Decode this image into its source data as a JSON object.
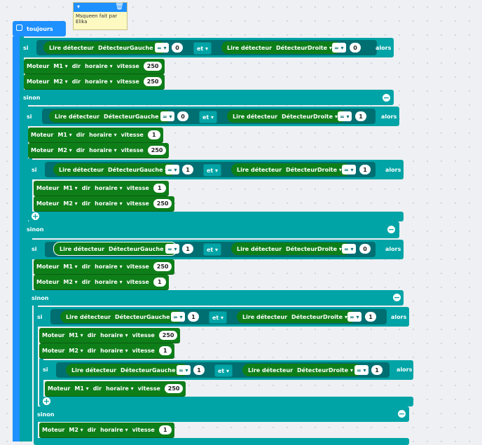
{
  "comment": {
    "text": "Msqueen fait par Elika"
  },
  "blocks": {
    "forever": "toujours",
    "if": "si",
    "else": "sinon",
    "then": "alors",
    "and": "et",
    "read_sensor": "Lire détecteur",
    "motor": "Moteur",
    "dir": "dir",
    "speed": "vitesse",
    "equals": "=",
    "detector_left": "DétecteurGauche",
    "detector_right": "DétecteurDroite",
    "m1": "M1",
    "m2": "M2",
    "clockwise": "horaire"
  },
  "values": {
    "zero": "0",
    "one": "1",
    "speed_250": "250"
  }
}
